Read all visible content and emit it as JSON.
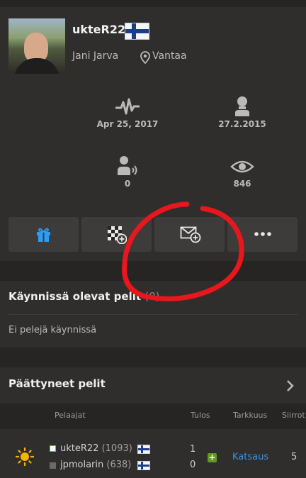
{
  "profile": {
    "username": "ukteR22",
    "real_name": "Jani Jarva",
    "location": "Vantaa",
    "country_flag": "finland-flag"
  },
  "stats": {
    "last_seen": "Apr 25, 2017",
    "member_since": "27.2.2015",
    "followers": "0",
    "views": "846"
  },
  "actions": [
    {
      "icon": "gift-icon"
    },
    {
      "icon": "challenge-icon"
    },
    {
      "icon": "message-icon"
    },
    {
      "icon": "more-icon"
    }
  ],
  "ongoing": {
    "title": "Käynnissä olevat pelit",
    "count": "(0)",
    "empty_text": "Ei pelejä käynnissä"
  },
  "finished": {
    "title": "Päättyneet pelit",
    "headers": {
      "players": "Pelaajat",
      "result": "Tulos",
      "accuracy": "Tarkkuus",
      "moves": "Siirrot"
    },
    "games": [
      {
        "white": {
          "name": "ukteR22",
          "rating": "(1093)"
        },
        "black": {
          "name": "jpmolarin",
          "rating": "(638)"
        },
        "white_score": "1",
        "black_score": "0",
        "accuracy_link": "Katsaus",
        "moves": "5"
      }
    ]
  },
  "colors": {
    "background": "#262523",
    "card": "#302e2c",
    "accent_blue": "#3692e7",
    "gift_blue": "#2a9df4",
    "win_green": "#629924",
    "annotation_red": "#e8161d"
  }
}
